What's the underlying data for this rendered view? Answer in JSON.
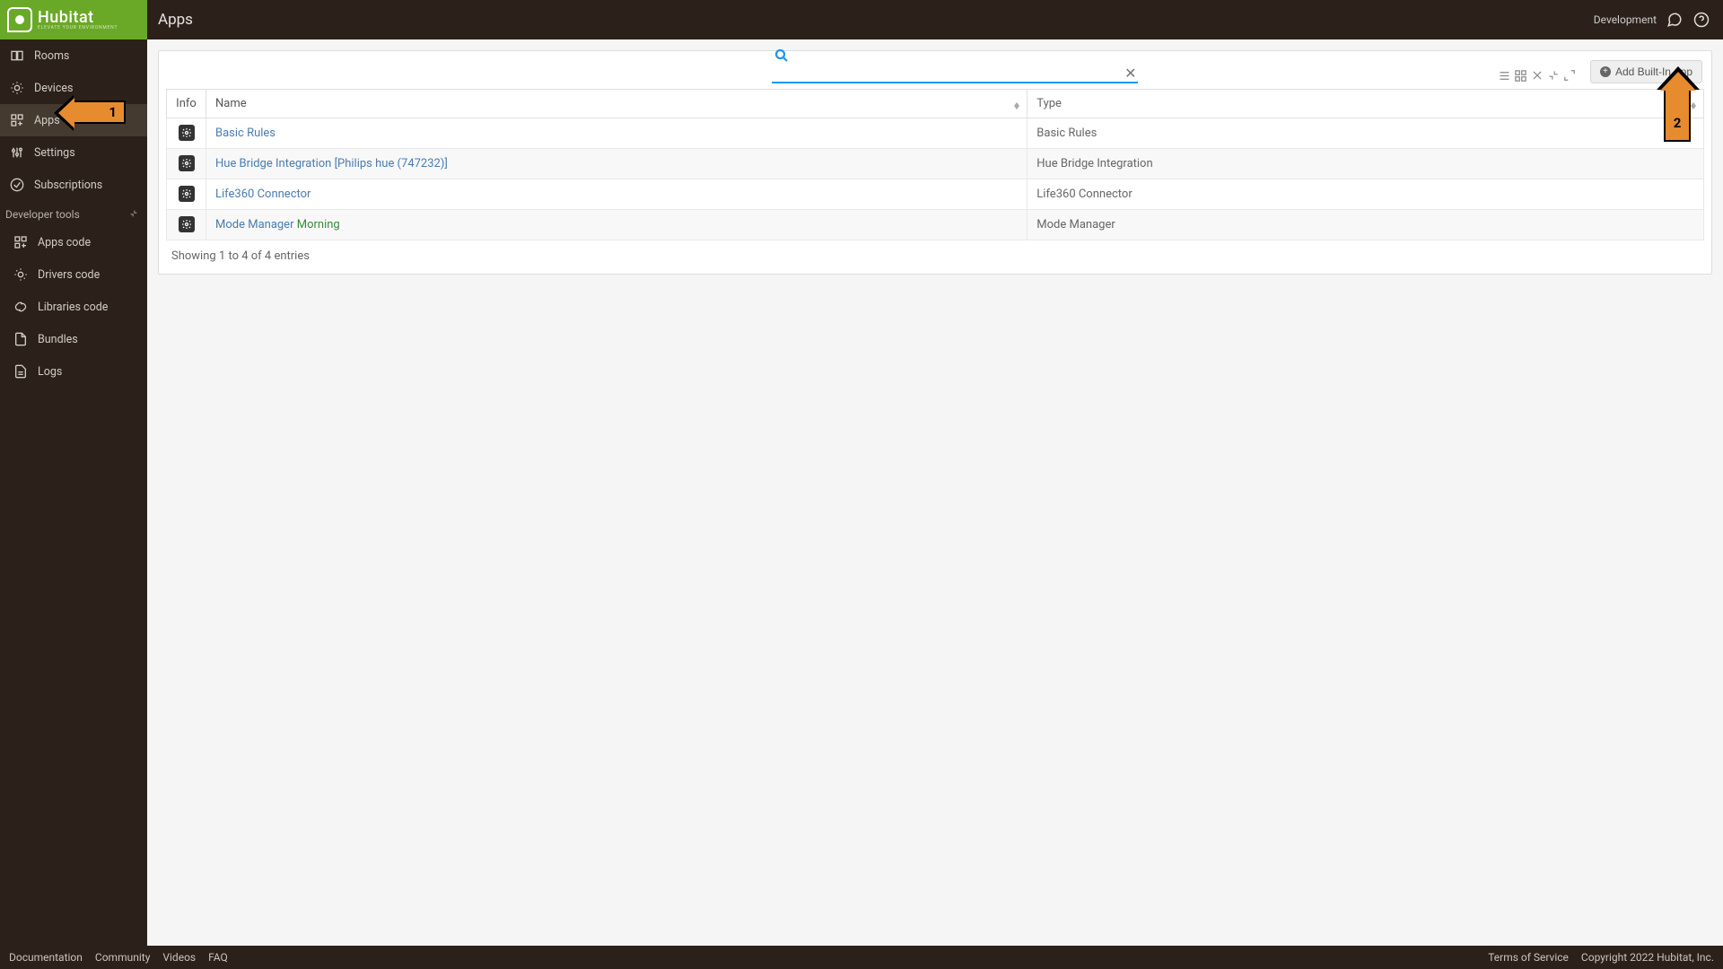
{
  "brand": {
    "name": "Hubitat",
    "tagline": "ELEVATE YOUR ENVIRONMENT"
  },
  "page_title": "Apps",
  "header": {
    "env": "Development"
  },
  "sidebar": {
    "items": [
      {
        "label": "Rooms",
        "icon": "rooms"
      },
      {
        "label": "Devices",
        "icon": "devices"
      },
      {
        "label": "Apps",
        "icon": "apps",
        "active": true
      },
      {
        "label": "Settings",
        "icon": "settings"
      },
      {
        "label": "Subscriptions",
        "icon": "subscriptions"
      }
    ],
    "dev_header": "Developer tools",
    "dev_items": [
      {
        "label": "Apps code",
        "icon": "apps-code"
      },
      {
        "label": "Drivers code",
        "icon": "drivers-code"
      },
      {
        "label": "Libraries code",
        "icon": "libraries-code"
      },
      {
        "label": "Bundles",
        "icon": "bundles"
      },
      {
        "label": "Logs",
        "icon": "logs"
      }
    ]
  },
  "toolbar": {
    "add_button": "Add Built-In App"
  },
  "table": {
    "headers": {
      "info": "Info",
      "name": "Name",
      "type": "Type"
    },
    "rows": [
      {
        "name": "Basic Rules",
        "suffix": "",
        "type": "Basic Rules"
      },
      {
        "name": "Hue Bridge Integration [Philips hue (747232)]",
        "suffix": "",
        "type": "Hue Bridge Integration"
      },
      {
        "name": "Life360 Connector",
        "suffix": "",
        "type": "Life360 Connector"
      },
      {
        "name": "Mode Manager",
        "suffix": "Morning",
        "type": "Mode Manager"
      }
    ],
    "footer": "Showing 1 to 4 of 4 entries"
  },
  "footer": {
    "left": [
      "Documentation",
      "Community",
      "Videos",
      "FAQ"
    ],
    "right": [
      "Terms of Service",
      "Copyright 2022 Hubitat, Inc."
    ]
  },
  "annotations": {
    "arrow1": "1",
    "arrow2": "2"
  }
}
